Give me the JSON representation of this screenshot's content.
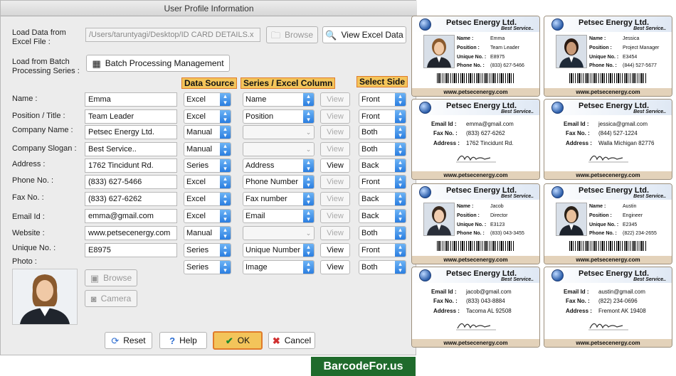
{
  "window": {
    "title": "User Profile Information"
  },
  "load_data": {
    "label": "Load Data from\nExcel File :",
    "path": "/Users/taruntyagi/Desktop/ID CARD DETAILS.x",
    "browse_label": "Browse",
    "view_excel_label": "View Excel Data"
  },
  "batch": {
    "label": "Load from Batch\nProcessing Series :",
    "button_label": "Batch Processing Management"
  },
  "headers": {
    "data_source": "Data Source",
    "series_column": "Series / Excel Column",
    "select_side": "Select Side"
  },
  "rows": [
    {
      "label": "Name :",
      "value": "Emma",
      "source": "Excel",
      "column": "Name",
      "view": "View",
      "view_enabled": false,
      "side": "Front"
    },
    {
      "label": "Position / Title :",
      "value": "Team Leader",
      "source": "Excel",
      "column": "Position",
      "view": "View",
      "view_enabled": false,
      "side": "Front"
    },
    {
      "label": "Company Name :",
      "value": "Petsec Energy Ltd.",
      "source": "Manual",
      "column": "",
      "view": "View",
      "view_enabled": false,
      "side": "Both"
    },
    {
      "label": "Company Slogan :",
      "value": "Best Service..",
      "source": "Manual",
      "column": "",
      "view": "View",
      "view_enabled": false,
      "side": "Both"
    },
    {
      "label": "Address :",
      "value": "1762 Tincidunt Rd.",
      "source": "Series",
      "column": "Address",
      "view": "View",
      "view_enabled": true,
      "side": "Back"
    },
    {
      "label": "Phone No. :",
      "value": "(833) 627-5466",
      "source": "Excel",
      "column": "Phone Number",
      "view": "View",
      "view_enabled": false,
      "side": "Front"
    },
    {
      "label": "Fax No. :",
      "value": "(833) 627-6262",
      "source": "Excel",
      "column": "Fax number",
      "view": "View",
      "view_enabled": false,
      "side": "Back"
    },
    {
      "label": "Email Id :",
      "value": "emma@gmail.com",
      "source": "Excel",
      "column": "Email",
      "view": "View",
      "view_enabled": false,
      "side": "Back"
    },
    {
      "label": "Website :",
      "value": "www.petsecenergy.com",
      "source": "Manual",
      "column": "",
      "view": "View",
      "view_enabled": false,
      "side": "Both"
    },
    {
      "label": "Unique No. :",
      "value": "E8975",
      "source": "Series",
      "column": "Unique Number",
      "view": "View",
      "view_enabled": true,
      "side": "Front"
    },
    {
      "label": "Photo :",
      "value": "",
      "source": "Series",
      "column": "Image",
      "view": "View",
      "view_enabled": true,
      "side": "Both"
    }
  ],
  "photo_buttons": {
    "browse": "Browse",
    "camera": "Camera"
  },
  "footer_buttons": {
    "reset": "Reset",
    "help": "Help",
    "ok": "OK",
    "cancel": "Cancel"
  },
  "cards_front": [
    {
      "company": "Petsec Energy Ltd.",
      "slogan": "Best Service..",
      "name_k": "Name :",
      "name": "Emma",
      "pos_k": "Position :",
      "position": "Team Leader",
      "uid_k": "Unique No. :",
      "uid": "E8975",
      "ph_k": "Phone No. :",
      "phone": "(833) 627-5466",
      "site": "www.petsecenergy.com"
    },
    {
      "company": "Petsec Energy Ltd.",
      "slogan": "Best Service..",
      "name_k": "Name :",
      "name": "Jessica",
      "pos_k": "Position :",
      "position": "Project Manager",
      "uid_k": "Unique No. :",
      "uid": "E3454",
      "ph_k": "Phone No. :",
      "phone": "(844) 527-5677",
      "site": "www.petsecenergy.com"
    },
    {
      "company": "Petsec Energy Ltd.",
      "slogan": "Best Service..",
      "name_k": "Name :",
      "name": "Jacob",
      "pos_k": "Position :",
      "position": "Director",
      "uid_k": "Unique No. :",
      "uid": "E3123",
      "ph_k": "Phone No. :",
      "phone": "(833) 043-3455",
      "site": "www.petsecenergy.com"
    },
    {
      "company": "Petsec Energy Ltd.",
      "slogan": "Best Service..",
      "name_k": "Name :",
      "name": "Austin",
      "pos_k": "Position :",
      "position": "Engineer",
      "uid_k": "Unique No. :",
      "uid": "E2345",
      "ph_k": "Phone No. :",
      "phone": "(822) 234-2655",
      "site": "www.petsecenergy.com"
    }
  ],
  "cards_back": [
    {
      "company": "Petsec Energy Ltd.",
      "slogan": "Best Service..",
      "email_k": "Email Id :",
      "email": "emma@gmail.com",
      "fax_k": "Fax No. :",
      "fax": "(833) 627-6262",
      "addr_k": "Address :",
      "address": "1762 Tincidunt Rd.",
      "site": "www.petsecenergy.com"
    },
    {
      "company": "Petsec Energy Ltd.",
      "slogan": "Best Service..",
      "email_k": "Email Id :",
      "email": "jessica@gmail.com",
      "fax_k": "Fax No. :",
      "fax": "(844) 527-1224",
      "addr_k": "Address :",
      "address": "Walla Michigan 82776",
      "site": "www.petsecenergy.com"
    },
    {
      "company": "Petsec Energy Ltd.",
      "slogan": "Best Service..",
      "email_k": "Email Id :",
      "email": "jacob@gmail.com",
      "fax_k": "Fax No. :",
      "fax": "(833) 043-8884",
      "addr_k": "Address :",
      "address": "Tacoma AL 92508",
      "site": "www.petsecenergy.com"
    },
    {
      "company": "Petsec Energy Ltd.",
      "slogan": "Best Service..",
      "email_k": "Email Id :",
      "email": "austin@gmail.com",
      "fax_k": "Fax No. :",
      "fax": "(822) 234-0696",
      "addr_k": "Address :",
      "address": "Fremont AK 19408",
      "site": "www.petsecenergy.com"
    }
  ],
  "watermark": "BarcodeFor.us",
  "colors": {
    "header_fill": "#f3c45a",
    "header_border": "#e07b2a",
    "select_arrow": "#2a7de0",
    "card_footer": "#e3d2ba",
    "watermark_bg": "#1f6b2c"
  }
}
